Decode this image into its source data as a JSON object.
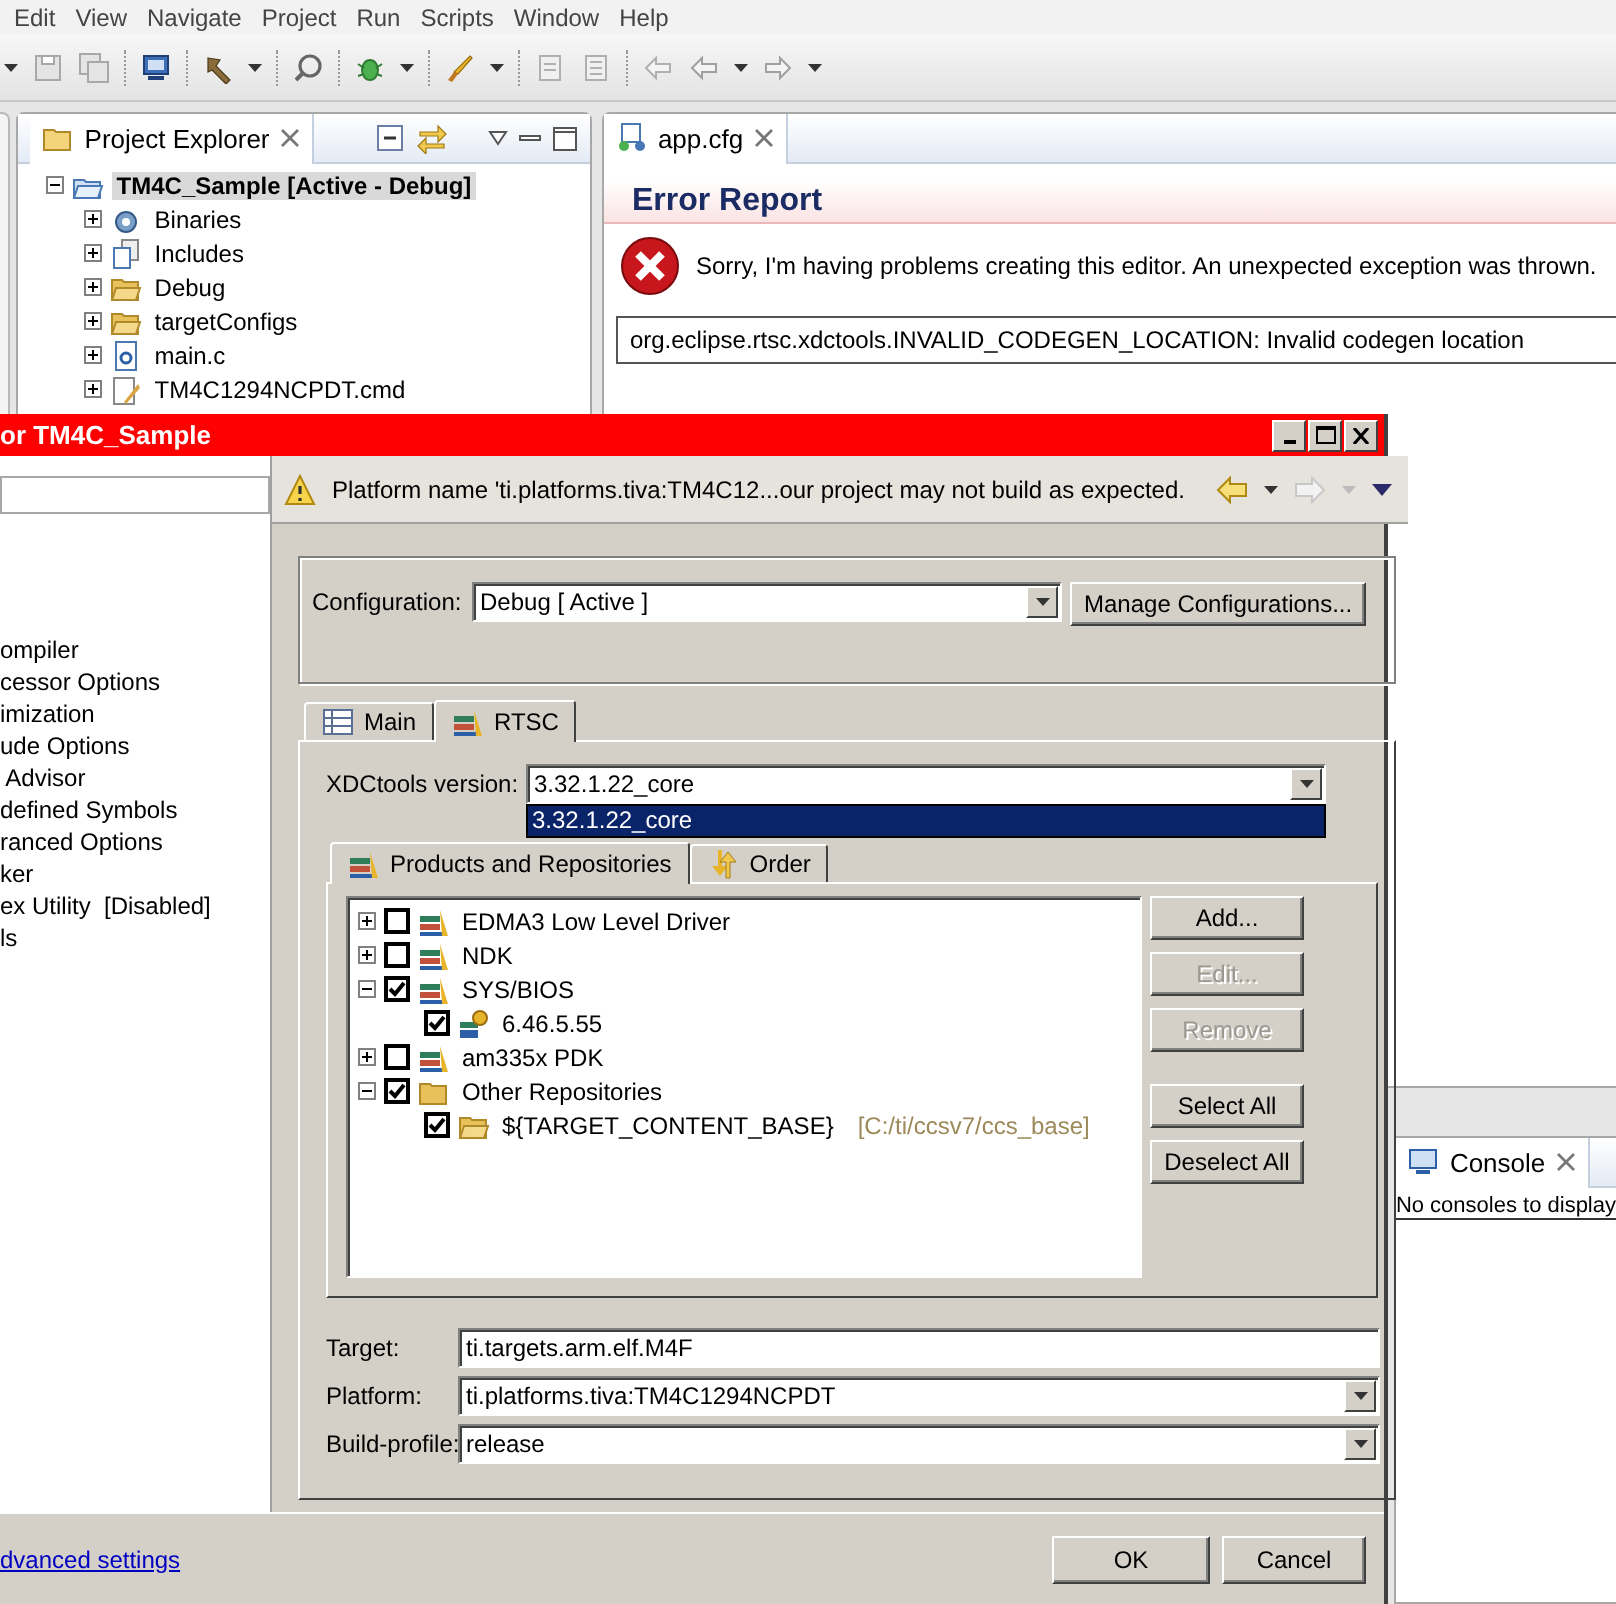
{
  "menu": [
    "Edit",
    "View",
    "Navigate",
    "Project",
    "Run",
    "Scripts",
    "Window",
    "Help"
  ],
  "project_explorer": {
    "title": "Project Explorer",
    "tree": [
      {
        "label": "TM4C_Sample  [Active - Debug]",
        "kind": "project",
        "expanded": true,
        "selected": true,
        "children": [
          {
            "label": "Binaries",
            "kind": "binaries",
            "expanded": false
          },
          {
            "label": "Includes",
            "kind": "includes",
            "expanded": false
          },
          {
            "label": "Debug",
            "kind": "folder",
            "expanded": false
          },
          {
            "label": "targetConfigs",
            "kind": "folder",
            "expanded": false
          },
          {
            "label": "main.c",
            "kind": "c-file",
            "expanded": false
          },
          {
            "label": "TM4C1294NCPDT.cmd",
            "kind": "cmd-file",
            "expanded": false
          }
        ]
      }
    ]
  },
  "editor": {
    "tab": "app.cfg",
    "heading": "Error Report",
    "message": "Sorry, I'm having problems creating this editor. An unexpected exception was thrown.",
    "detail": "org.eclipse.rtsc.xdctools.INVALID_CODEGEN_LOCATION: Invalid codegen location"
  },
  "console": {
    "tab": "Console",
    "message": "No consoles to display"
  },
  "dialog": {
    "title": "or TM4C_Sample",
    "nav": [
      "ompiler",
      "cessor Options",
      "imization",
      "ude Options",
      " Advisor",
      "defined Symbols",
      "ranced Options",
      "ker",
      "ex Utility  [Disabled]",
      "ls"
    ],
    "message": "Platform name 'ti.platforms.tiva:TM4C12...our project may not build as expected.",
    "configuration": {
      "label": "Configuration:",
      "value": "Debug  [ Active ]"
    },
    "manage_button": "Manage Configurations...",
    "tabs": [
      {
        "label": "Main",
        "kind": "table",
        "selected": false
      },
      {
        "label": "RTSC",
        "kind": "books",
        "selected": true
      }
    ],
    "xdctools": {
      "label": "XDCtools version:",
      "value": "3.32.1.22_core",
      "options": [
        {
          "label": "3.32.1.22_core",
          "selected": true
        }
      ]
    },
    "inner_tabs": [
      {
        "label": "Products and Repositories",
        "kind": "books",
        "selected": true
      },
      {
        "label": "Order",
        "kind": "order",
        "selected": false
      }
    ],
    "products": [
      {
        "label": "EDMA3 Low Level Driver",
        "kind": "product",
        "checked": false,
        "expanded": false
      },
      {
        "label": "NDK",
        "kind": "product",
        "checked": false,
        "expanded": false
      },
      {
        "label": "SYS/BIOS",
        "kind": "product",
        "checked": true,
        "expanded": true,
        "children": [
          {
            "label": "6.46.5.55",
            "kind": "version",
            "checked": true
          }
        ]
      },
      {
        "label": "am335x PDK",
        "kind": "product",
        "checked": false,
        "expanded": false
      },
      {
        "label": "Other Repositories",
        "kind": "repository",
        "checked": true,
        "expanded": true,
        "children": [
          {
            "label": "${TARGET_CONTENT_BASE}",
            "note": "[C:/ti/ccsv7/ccs_base]",
            "kind": "folder",
            "checked": true
          }
        ]
      }
    ],
    "side_buttons": [
      {
        "label": "Add...",
        "disabled": false
      },
      {
        "label": "Edit...",
        "disabled": true
      },
      {
        "label": "Remove",
        "disabled": true
      },
      {
        "label": "Select All",
        "disabled": false
      },
      {
        "label": "Deselect All",
        "disabled": false
      }
    ],
    "fields": [
      {
        "label": "Target:",
        "value": "ti.targets.arm.elf.M4F",
        "kind": "text"
      },
      {
        "label": "Platform:",
        "value": "ti.platforms.tiva:TM4C1294NCPDT",
        "kind": "select"
      },
      {
        "label": "Build-profile:",
        "value": "release",
        "kind": "select"
      }
    ],
    "link": "dvanced settings",
    "buttons": [
      "OK",
      "Cancel"
    ]
  }
}
